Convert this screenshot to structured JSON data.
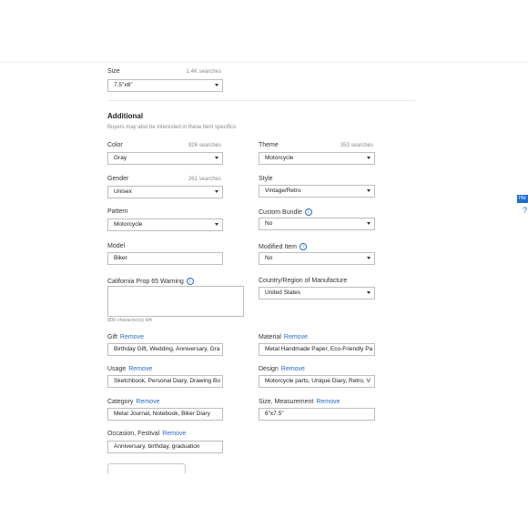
{
  "size": {
    "label": "Size",
    "count": "1.4K searches",
    "value": "7.5\"x6\""
  },
  "additional": {
    "heading": "Additional",
    "subtitle": "Buyers may also be interested in these item specifics"
  },
  "color": {
    "label": "Color",
    "count": "926 searches",
    "value": "Gray"
  },
  "theme": {
    "label": "Theme",
    "count": "353 searches",
    "value": "Motorcycle"
  },
  "gender": {
    "label": "Gender",
    "count": "261 searches",
    "value": "Unisex"
  },
  "style": {
    "label": "Style",
    "value": "Vintage/Retro"
  },
  "pattern": {
    "label": "Pattern",
    "value": "Motorcycle"
  },
  "custom_bundle": {
    "label": "Custom Bundle",
    "value": "No"
  },
  "model": {
    "label": "Model",
    "value": "Biker"
  },
  "modified_item": {
    "label": "Modified Item",
    "value": "No"
  },
  "prop65": {
    "label": "California Prop 65 Warning",
    "chars_left": "800 character(s) left"
  },
  "country": {
    "label": "Country/Region of Manufacture",
    "value": "United States"
  },
  "gift": {
    "label": "Gift",
    "remove": "Remove",
    "value": "Birthday Gift, Wedding, Anniversary, Gra"
  },
  "material": {
    "label": "Material",
    "remove": "Remove",
    "value": "Metal Handmade Paper, Eco-Friendly Pa"
  },
  "usage": {
    "label": "Usage",
    "remove": "Remove",
    "value": "Sketchbook, Personal Diary, Drawing Bo"
  },
  "design": {
    "label": "Design",
    "remove": "Remove",
    "value": "Motorcycle parts,  Unique Diary, Retro, V"
  },
  "category": {
    "label": "Category",
    "remove": "Remove",
    "value": "Metal Journal, Notebook, Biker Diary"
  },
  "size_measurement": {
    "label": "Size, Measurement",
    "remove": "Remove",
    "value": "6\"x7.5\""
  },
  "occasion": {
    "label": "Occasion, Festival",
    "remove": "Remove",
    "value": "Anniversary, birthday, graduation"
  },
  "side": {
    "tab": "He",
    "icon": "?"
  },
  "icons": {
    "info": "info-icon",
    "caret": "chevron-down-icon"
  },
  "colors": {
    "link": "#2a6ac5",
    "border": "#bdbdbd",
    "accent": "#1f6fd1"
  }
}
